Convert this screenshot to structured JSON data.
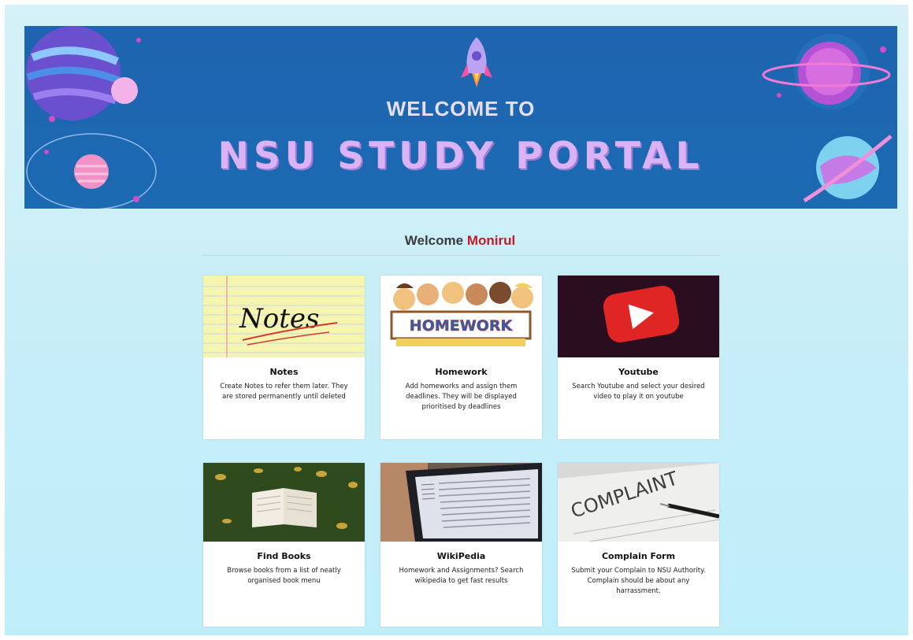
{
  "banner": {
    "welcome_to": "WELCOME TO",
    "title": "NSU STUDY PORTAL"
  },
  "welcome": {
    "prefix": "Welcome",
    "username": "Monirul"
  },
  "cards": [
    {
      "id": "notes",
      "title": "Notes",
      "description": "Create Notes to refer them later. They are stored permanently until deleted",
      "image_text": "Notes",
      "icon": "notes-paper-icon"
    },
    {
      "id": "homework",
      "title": "Homework",
      "description": "Add homeworks and assign them deadlines. They will be displayed prioritised by deadlines",
      "image_text": "HOMEWORK",
      "icon": "homework-kids-icon"
    },
    {
      "id": "youtube",
      "title": "Youtube",
      "description": "Search Youtube and select your desired video to play it on youtube",
      "icon": "youtube-play-icon"
    },
    {
      "id": "find-books",
      "title": "Find Books",
      "description": "Browse books from a list of neatly organised book menu",
      "icon": "open-book-icon"
    },
    {
      "id": "wikipedia",
      "title": "WikiPedia",
      "description": "Homework and Assignments? Search wikipedia to get fast results",
      "icon": "laptop-wiki-icon"
    },
    {
      "id": "complain",
      "title": "Complain Form",
      "description": "Submit your Complain to NSU Authority. Complain should be about any harrassment.",
      "image_text": "COMPLAINT",
      "icon": "complaint-form-icon"
    }
  ],
  "colors": {
    "banner_bg": "#1f64b0",
    "title_purple": "#d9b3f5",
    "username_red": "#c01b2b",
    "page_bg": "#c8eef7"
  }
}
